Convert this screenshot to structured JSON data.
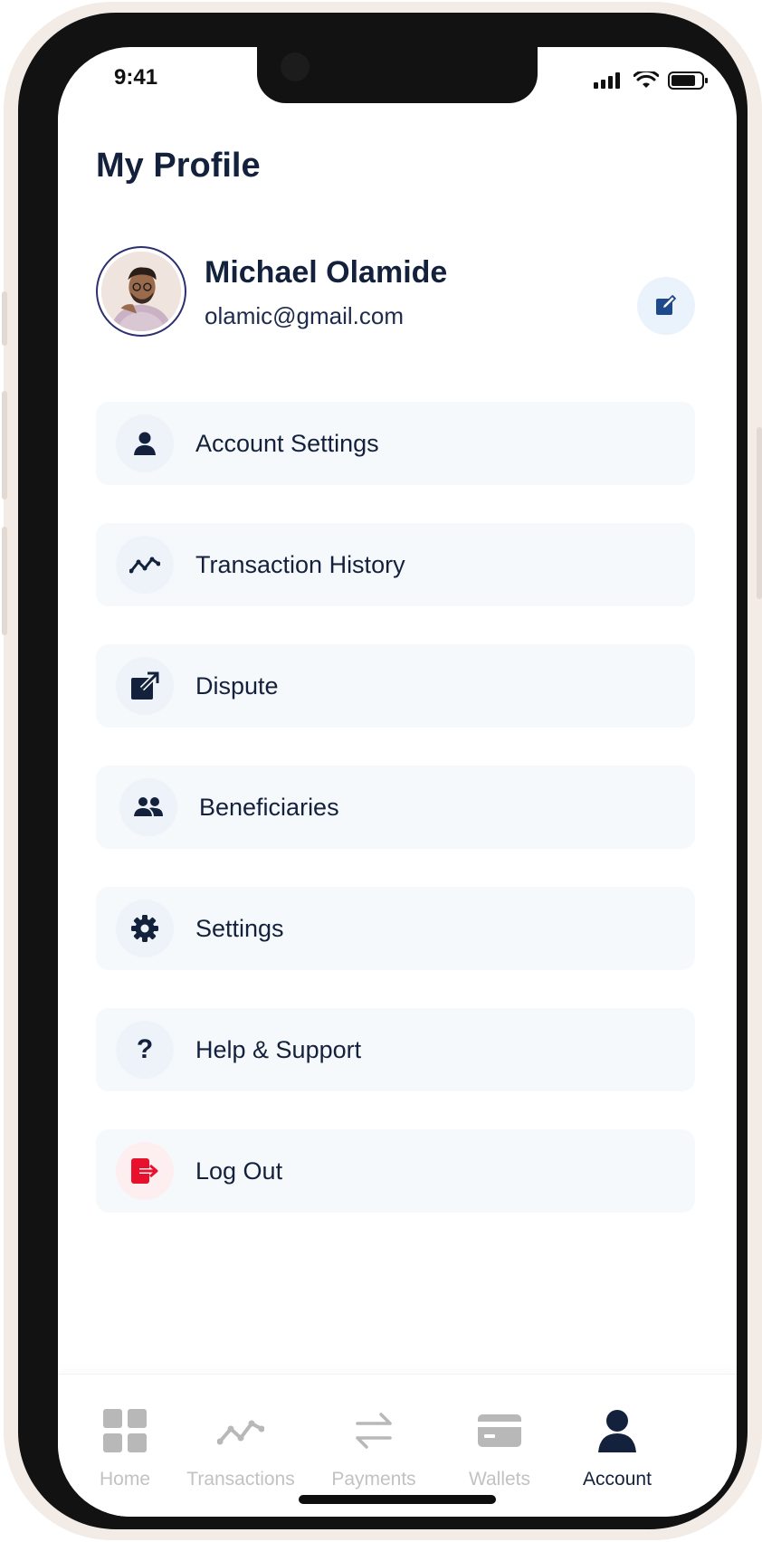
{
  "status_bar": {
    "time": "9:41"
  },
  "header": {
    "title": "My Profile"
  },
  "profile": {
    "name": "Michael Olamide",
    "email": "olamic@gmail.com"
  },
  "menu": [
    {
      "label": "Account Settings",
      "icon": "user-icon"
    },
    {
      "label": "Transaction History",
      "icon": "trend-line-icon"
    },
    {
      "label": "Dispute",
      "icon": "external-link-icon"
    },
    {
      "label": "Beneficiaries",
      "icon": "users-icon"
    },
    {
      "label": "Settings",
      "icon": "gear-icon"
    },
    {
      "label": "Help & Support",
      "icon": "question-icon",
      "glyph": "?"
    },
    {
      "label": "Log Out",
      "icon": "logout-icon"
    }
  ],
  "tabbar": {
    "tabs": [
      {
        "label": "Home",
        "icon": "grid-icon"
      },
      {
        "label": "Transactions",
        "icon": "trend-line-icon"
      },
      {
        "label": "Payments",
        "icon": "transfer-arrows-icon"
      },
      {
        "label": "Wallets",
        "icon": "card-icon"
      },
      {
        "label": "Account",
        "icon": "user-icon"
      }
    ],
    "active": "Account"
  },
  "colors": {
    "primary_text": "#14213d",
    "edit_icon": "#1e4a8c",
    "logout_accent": "#e8112d",
    "inactive_tab": "#c2c2c2",
    "menu_background": "#f6f9fc"
  }
}
